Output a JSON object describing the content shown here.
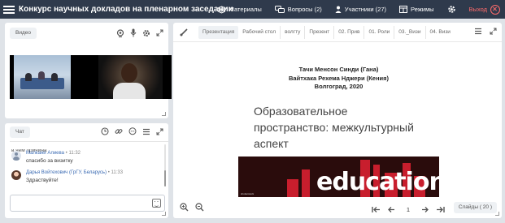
{
  "header": {
    "title": "Конкурс научных докладов на пленарном заседании",
    "nav": {
      "materials": "Материалы",
      "questions": "Вопросы (2)",
      "participants": "Участники (27)",
      "modes": "Режимы",
      "exit": "Выход"
    }
  },
  "video_panel": {
    "label": "Видео"
  },
  "chat_panel": {
    "label": "Чат",
    "cut_text": "в чем причина",
    "messages": [
      {
        "author": "Малкани Алиева",
        "time": "11:32",
        "text": "спасибо за визитку"
      },
      {
        "author": "Дарья Войтехович (ГрГУ, Беларусь)",
        "time": "11:33",
        "text": "Здраствуйте!"
      }
    ],
    "input_placeholder": ""
  },
  "presentation": {
    "tabs": [
      "Презентация",
      "Рабочий стол",
      "волгту",
      "Презент",
      "02. Прив",
      "01. Роли",
      "03._Визи",
      "04. Визи"
    ],
    "active_tab_index": 0,
    "slide": {
      "authors_line1": "Тачи Менсон Синди (Гана)",
      "authors_line2": "Вайтхака Рехема Нджери (Кения)",
      "authors_line3": "Волгоград, 2020",
      "title": "Образовательное пространство: межкультурный аспект",
      "banner_word": "education",
      "credit": "shutterstock"
    },
    "current_page": "1",
    "slides_label": "Слайды ( 20 )"
  },
  "colors": {
    "topbar": "#2f3a4c",
    "exit": "#ff6b6b",
    "author_link": "#3b6bb3",
    "banner_dark": "#2a0c0c",
    "banner_red": "#c81e2d"
  }
}
